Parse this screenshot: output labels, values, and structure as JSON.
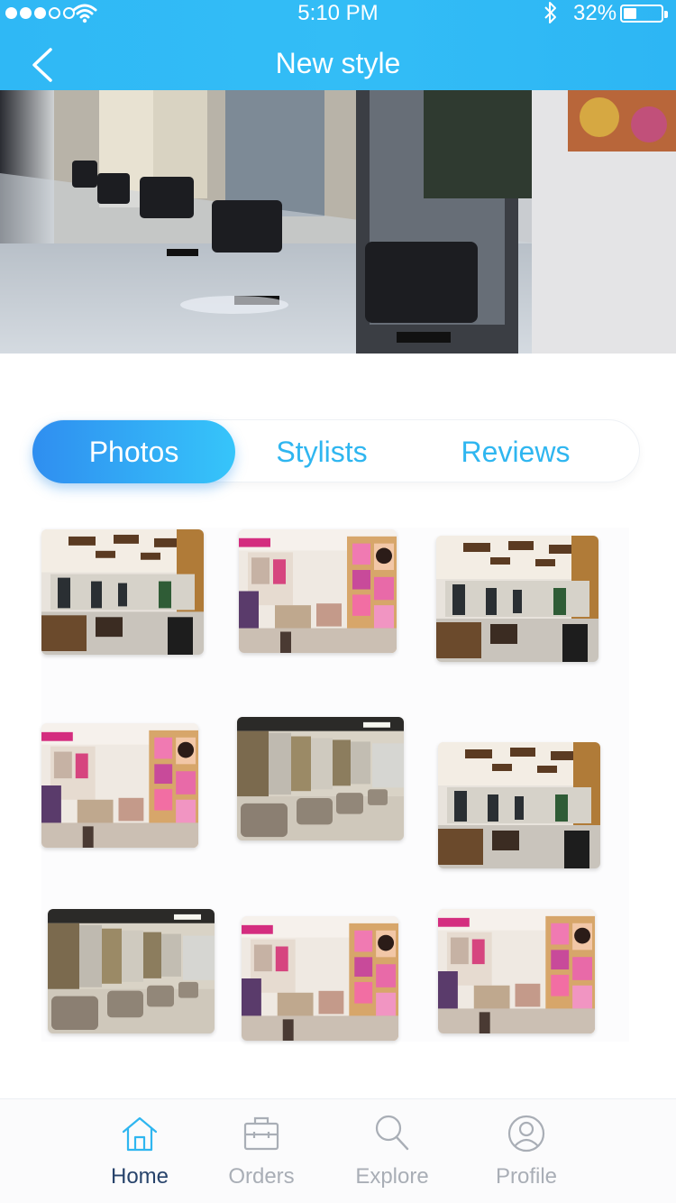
{
  "status_bar": {
    "time": "5:10 PM",
    "battery": "32%",
    "signal_icon": "signal-dots-icon",
    "wifi_icon": "wifi-icon",
    "bluetooth_icon": "bluetooth-icon"
  },
  "header": {
    "title": "New style",
    "back_icon": "chevron-left-icon",
    "color": "#33bdf6"
  },
  "hero": {
    "image": "salon-interior-photo"
  },
  "tabs": [
    {
      "label": "Photos",
      "active": true
    },
    {
      "label": "Stylists",
      "active": false
    },
    {
      "label": "Reviews",
      "active": false
    }
  ],
  "photos": [
    {
      "scene": "salon-ceiling-lights"
    },
    {
      "scene": "salon-pink-posters"
    },
    {
      "scene": "salon-ceiling-lights"
    },
    {
      "scene": "salon-pink-posters"
    },
    {
      "scene": "salon-chairs-mirrors"
    },
    {
      "scene": "salon-ceiling-lights"
    },
    {
      "scene": "salon-chairs-mirrors"
    },
    {
      "scene": "salon-pink-posters"
    },
    {
      "scene": "salon-pink-posters"
    }
  ],
  "bottom_nav": [
    {
      "label": "Home",
      "icon": "home-icon",
      "active": true
    },
    {
      "label": "Orders",
      "icon": "briefcase-icon",
      "active": false
    },
    {
      "label": "Explore",
      "icon": "search-icon",
      "active": false
    },
    {
      "label": "Profile",
      "icon": "user-icon",
      "active": false
    }
  ],
  "colors": {
    "accent": "#2fb6f0",
    "tab_active_start": "#2f8ef0",
    "tab_active_end": "#36c5fa",
    "nav_active": "#27436b",
    "nav_inactive": "#a9aeb6"
  }
}
